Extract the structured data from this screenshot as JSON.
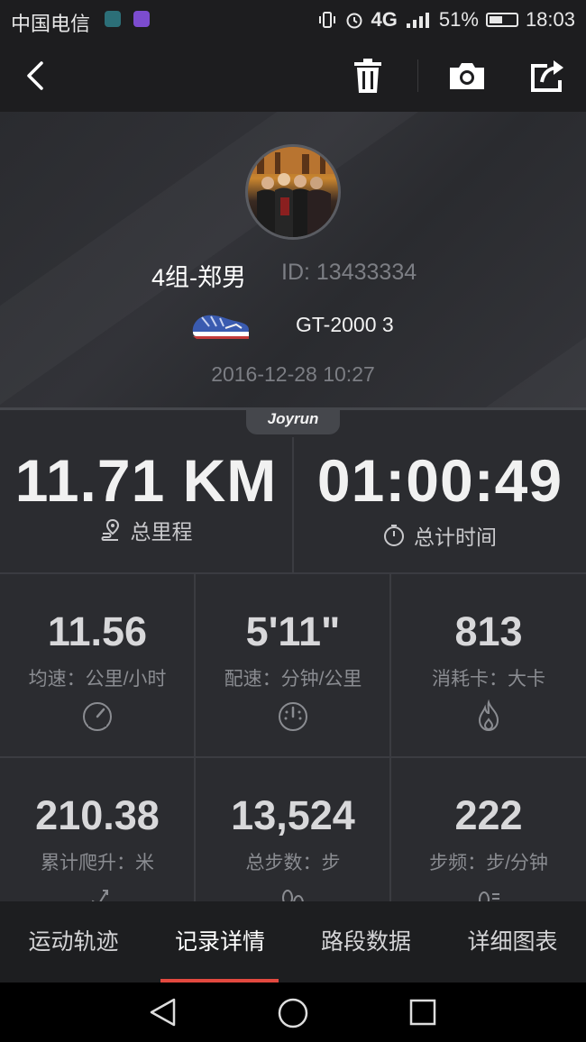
{
  "status_bar": {
    "carrier": "中国电信",
    "network": "4G",
    "battery": "51%",
    "battery_level": 0.51,
    "time": "18:03"
  },
  "toolbar": {
    "back_icon": "back-arrow-icon",
    "delete_icon": "trash-icon",
    "camera_icon": "camera-icon",
    "share_icon": "share-icon"
  },
  "profile": {
    "name": "4组-郑男",
    "id": "ID: 13433334",
    "shoe": "GT-2000 3",
    "datetime": "2016-12-28 10:27"
  },
  "brand_tag": "Joyrun",
  "summary": {
    "distance": {
      "value": "11.71 KM",
      "label": "总里程"
    },
    "duration": {
      "value": "01:00:49",
      "label": "总计时间"
    }
  },
  "metrics": [
    {
      "value": "11.56",
      "label": "均速：公里/小时",
      "icon": "speedometer-icon"
    },
    {
      "value": "5'11\"",
      "label": "配速：分钟/公里",
      "icon": "pace-dial-icon"
    },
    {
      "value": "813",
      "label": "消耗卡：大卡",
      "icon": "flame-icon"
    },
    {
      "value": "210.38",
      "label": "累计爬升：米",
      "icon": "climb-icon"
    },
    {
      "value": "13,524",
      "label": "总步数：步",
      "icon": "footsteps-icon"
    },
    {
      "value": "222",
      "label": "步频：步/分钟",
      "icon": "cadence-icon"
    }
  ],
  "tabs": [
    {
      "label": "运动轨迹",
      "active": false
    },
    {
      "label": "记录详情",
      "active": true
    },
    {
      "label": "路段数据",
      "active": false
    },
    {
      "label": "详细图表",
      "active": false
    }
  ],
  "colors": {
    "accent": "#e2493f",
    "background": "#2b2c30",
    "bar": "#1d1e20"
  }
}
